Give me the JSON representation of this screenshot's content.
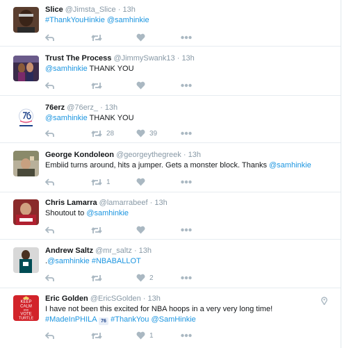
{
  "tweets": [
    {
      "name": "Slice",
      "handle": "@Jimsta_Slice",
      "separator": "·",
      "time": "13h",
      "text": [
        {
          "t": "#ThankYouHinkie",
          "link": true
        },
        {
          "t": " ",
          "link": false
        },
        {
          "t": "@samhinkie",
          "link": true
        }
      ],
      "retweets": "",
      "likes": ""
    },
    {
      "name": "Trust The Process",
      "handle": "@JimmySwank13",
      "separator": "·",
      "time": "13h",
      "text": [
        {
          "t": "@samhinkie",
          "link": true
        },
        {
          "t": " THANK YOU",
          "link": false
        }
      ],
      "retweets": "",
      "likes": ""
    },
    {
      "name": "76erz",
      "handle": "@76erz_",
      "separator": "·",
      "time": "13h",
      "text": [
        {
          "t": "@samhinkie",
          "link": true
        },
        {
          "t": " THANK YOU",
          "link": false
        }
      ],
      "retweets": "28",
      "likes": "39"
    },
    {
      "name": "George Kondoleon",
      "handle": "@georgeythegreek",
      "separator": "·",
      "time": "13h",
      "text": [
        {
          "t": "Embiid turns around, hits a jumper. Gets a monster block. Thanks ",
          "link": false
        },
        {
          "t": "@samhinkie",
          "link": true
        }
      ],
      "retweets": "1",
      "likes": ""
    },
    {
      "name": "Chris Lamarra",
      "handle": "@lamarrabeef",
      "separator": "·",
      "time": "13h",
      "text": [
        {
          "t": "Shoutout to ",
          "link": false
        },
        {
          "t": "@samhinkie",
          "link": true
        }
      ],
      "retweets": "",
      "likes": ""
    },
    {
      "name": "Andrew Saltz",
      "handle": "@mr_saltz",
      "separator": "·",
      "time": "13h",
      "text": [
        {
          "t": ".",
          "link": false
        },
        {
          "t": "@samhinkie",
          "link": true
        },
        {
          "t": " ",
          "link": false
        },
        {
          "t": "#NBABALLOT",
          "link": true
        }
      ],
      "retweets": "",
      "likes": "2"
    },
    {
      "name": "Eric Golden",
      "handle": "@EricSGolden",
      "separator": "·",
      "time": "13h",
      "text": [
        {
          "t": "I have not been this excited for NBA hoops in a very very long time!",
          "link": false
        }
      ],
      "text2": [
        {
          "t": "#MadeInPHILA",
          "link": true
        },
        {
          "t": " ",
          "link": false
        },
        {
          "t": "76",
          "link": false,
          "badge": true
        },
        {
          "t": " ",
          "link": false
        },
        {
          "t": "#ThankYou",
          "link": true
        },
        {
          "t": " ",
          "link": false
        },
        {
          "t": "@SamHinkie",
          "link": true
        }
      ],
      "retweets": "",
      "likes": "1",
      "avatar_text": [
        "KEEP",
        "CALM",
        "AND",
        "VOTE",
        "TURTLE"
      ]
    }
  ],
  "colors": {
    "link": "#1b95e0",
    "meta": "#8899a6",
    "divider": "#e6ecf0",
    "icon": "#aab8c2"
  }
}
